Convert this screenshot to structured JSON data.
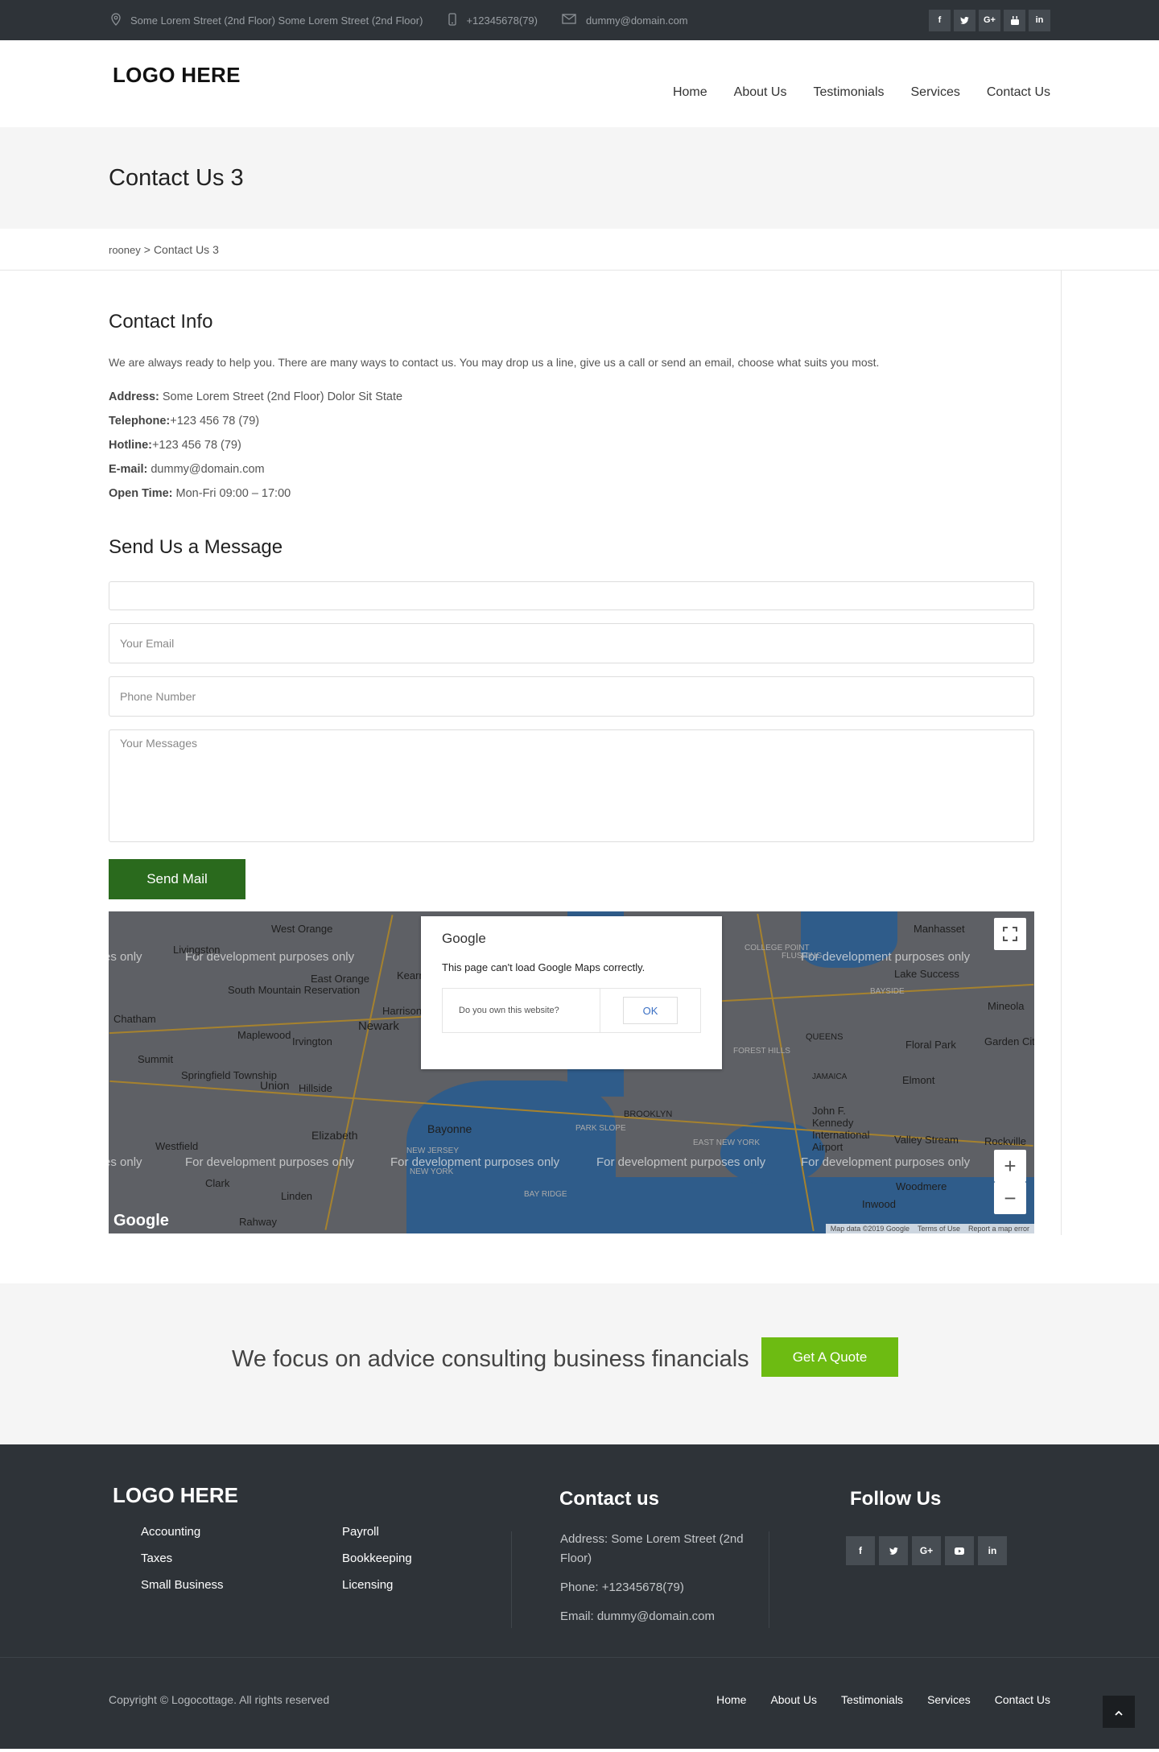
{
  "topbar": {
    "address": "Some Lorem Street (2nd Floor) Some Lorem Street (2nd Floor)",
    "phone": "+12345678(79)",
    "email": "dummy@domain.com",
    "socials": [
      "f",
      "t",
      "G+",
      "yt",
      "in"
    ]
  },
  "header": {
    "logo": "LOGO HERE",
    "nav": [
      "Home",
      "About Us",
      "Testimonials",
      "Services",
      "Contact Us"
    ]
  },
  "page_title": "Contact Us 3",
  "breadcrumb": {
    "root": "rooney",
    "separator": ">",
    "current": "Contact Us 3"
  },
  "contact_info": {
    "title": "Contact Info",
    "intro": "We are always ready to help you. There are many ways to contact us. You may drop us a line, give us a call or send an email, choose what suits you most.",
    "address_label": "Address:",
    "address": " Some Lorem Street (2nd Floor) Dolor Sit State",
    "telephone_label": "Telephone:",
    "telephone": "+123 456 78 (79)",
    "hotline_label": "Hotline:",
    "hotline": "+123 456 78 (79)",
    "email_label": "E-mail:",
    "email": " dummy@domain.com",
    "open_label": "Open Time:",
    "open": " Mon-Fri 09:00 – 17:00"
  },
  "form": {
    "title": "Send Us a Message",
    "name_value": "",
    "email_placeholder": "Your Email",
    "phone_placeholder": "Phone Number",
    "message_placeholder": "Your Messages",
    "submit": "Send Mail"
  },
  "map": {
    "dev_text": "For development purposes only",
    "dialog_brand": "Google",
    "dialog_message": "This page can't load Google Maps correctly.",
    "dialog_question": "Do you own this website?",
    "dialog_ok": "OK",
    "logo": "Google",
    "attribution": [
      "Map data ©2019 Google",
      "Terms of Use",
      "Report a map error"
    ],
    "places": [
      "West Orange",
      "Livingston",
      "East Orange",
      "South Mountain Reservation",
      "Newark",
      "Maplewood",
      "Irvington",
      "Harrison",
      "Chatham",
      "Summit",
      "Springfield Township",
      "Union",
      "Hillside",
      "Elizabeth",
      "Westfield",
      "Clark",
      "Linden",
      "Rahway",
      "Bayonne",
      "BROOKLYN",
      "PARK SLOPE",
      "EAST NEW YORK",
      "BAY RIDGE",
      "QUEENS",
      "FOREST HILLS",
      "JAMAICA",
      "Elmont",
      "Floral Park",
      "Garden City",
      "Mineola",
      "Manhasset",
      "Lake Success",
      "Valley Stream",
      "Rockville",
      "Woodmere",
      "Inwood",
      "John F. Kennedy International Airport",
      "FLUSHING",
      "BAYSIDE",
      "COLLEGE POINT",
      "NEW JERSEY",
      "NEW YORK",
      "Kearny"
    ]
  },
  "cta": {
    "text": "We focus on advice consulting business financials",
    "button": "Get A Quote"
  },
  "footer": {
    "logo": "LOGO HERE",
    "links": [
      "Accounting",
      "Payroll",
      "Taxes",
      "Bookkeeping",
      "Small Business",
      "Licensing"
    ],
    "contact_title": "Contact us",
    "contact_address": "Address: Some Lorem Street (2nd Floor)",
    "contact_phone": "Phone: +12345678(79)",
    "contact_email": "Email: dummy@domain.com",
    "follow_title": "Follow Us",
    "socials": [
      "f",
      "t",
      "G+",
      "yt",
      "in"
    ],
    "copyright": "Copyright © Logocottage. All rights reserved",
    "nav": [
      "Home",
      "About Us",
      "Testimonials",
      "Services",
      "Contact Us"
    ]
  }
}
